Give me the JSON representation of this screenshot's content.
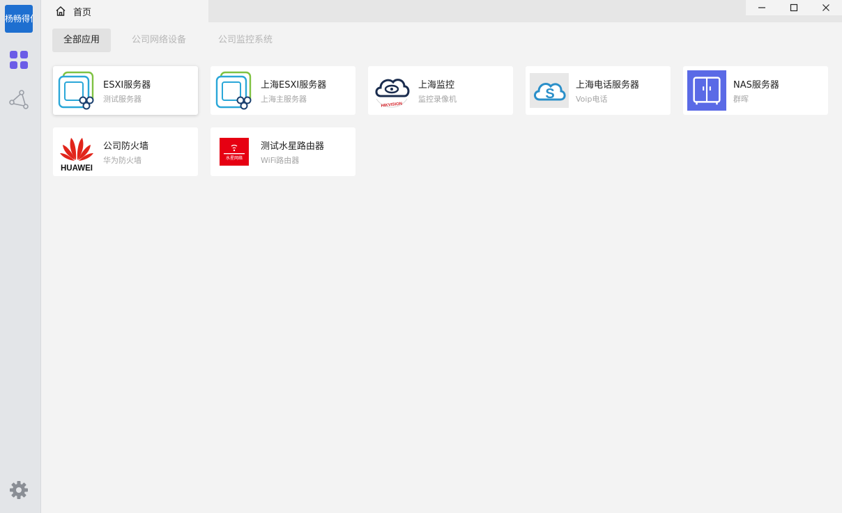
{
  "sidebar": {
    "logo_text": "杨畅得亿"
  },
  "titlebar": {
    "home_label": "首页"
  },
  "category_tabs": [
    {
      "label": "全部应用"
    },
    {
      "label": "公司网络设备"
    },
    {
      "label": "公司监控系统"
    }
  ],
  "apps": [
    {
      "title": "ESXI服务器",
      "subtitle": "测试服务器",
      "icon": "vmware-esxi-icon"
    },
    {
      "title": "上海ESXI服务器",
      "subtitle": "上海主服务器",
      "icon": "vmware-esxi-icon"
    },
    {
      "title": "上海监控",
      "subtitle": "监控录像机",
      "icon": "hikvision-icon"
    },
    {
      "title": "上海电话服务器",
      "subtitle": "Voip电话",
      "icon": "cloud-s-icon"
    },
    {
      "title": "NAS服务器",
      "subtitle": "群晖",
      "icon": "nas-icon"
    },
    {
      "title": "公司防火墙",
      "subtitle": "华为防火墙",
      "icon": "huawei-icon",
      "logo_text": "HUAWEI"
    },
    {
      "title": "测试水星路由器",
      "subtitle": "WiFi路由器",
      "icon": "mercury-router-icon",
      "logo_text": "水星网络"
    }
  ],
  "colors": {
    "accent": "#1e6fd0",
    "nav_active": "#6b5ce7",
    "nas": "#5a6ae6",
    "huawei": "#e1251b",
    "mercury": "#e60012"
  }
}
